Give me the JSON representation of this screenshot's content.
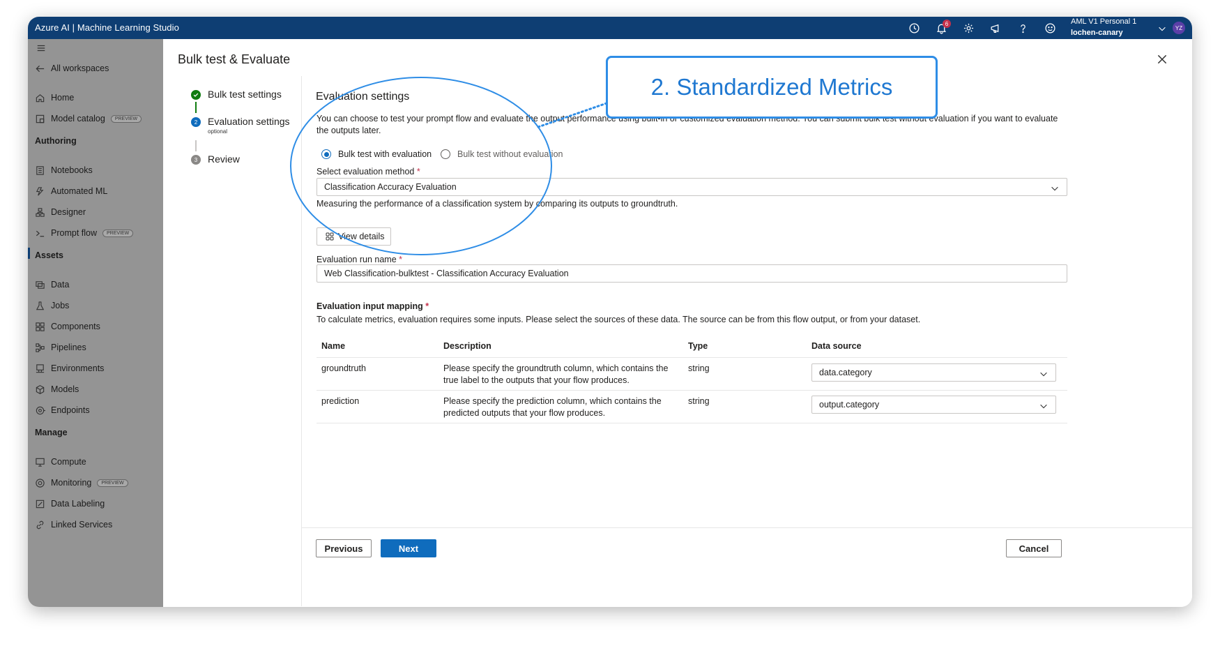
{
  "app": {
    "title": "Azure AI | Machine Learning Studio",
    "notification_count": "6",
    "account_name": "AML V1 Personal 1",
    "account_workspace": "lochen-canary",
    "avatar_initials": "YZ"
  },
  "sidebar": {
    "back": "All workspaces",
    "home": "Home",
    "model_catalog": "Model catalog",
    "preview_badge": "PREVIEW",
    "authoring_header": "Authoring",
    "notebooks": "Notebooks",
    "automated_ml": "Automated ML",
    "designer": "Designer",
    "prompt_flow": "Prompt flow",
    "assets_header": "Assets",
    "data": "Data",
    "jobs": "Jobs",
    "components": "Components",
    "pipelines": "Pipelines",
    "environments": "Environments",
    "models": "Models",
    "endpoints": "Endpoints",
    "manage_header": "Manage",
    "compute": "Compute",
    "monitoring": "Monitoring",
    "data_labeling": "Data Labeling",
    "linked_services": "Linked Services"
  },
  "panel": {
    "title": "Bulk test & Evaluate",
    "steps": {
      "s1": "Bulk test settings",
      "s2": "Evaluation settings",
      "s2_sub": "optional",
      "s2_num": "2",
      "s3": "Review",
      "s3_num": "3"
    },
    "section_title": "Evaluation settings",
    "description": "You can choose to test your prompt flow and evaluate the output performance using built-in or customized evaluation method. You can submit bulk test without evaluation if you want to evaluate the outputs later.",
    "radio_with": "Bulk test with evaluation",
    "radio_without": "Bulk test without evaluation",
    "method_label": "Select evaluation method",
    "method_value": "Classification Accuracy Evaluation",
    "method_desc": "Measuring the performance of a classification system by comparing its outputs to groundtruth.",
    "view_details": "View details",
    "run_name_label": "Evaluation run name",
    "run_name_value": "Web Classification-bulktest - Classification Accuracy Evaluation",
    "mapping_label": "Evaluation input mapping",
    "mapping_desc": "To calculate metrics, evaluation requires some inputs. Please select the sources of these data. The source can be from this flow output, or from your dataset.",
    "required_mark": "*",
    "table": {
      "headers": [
        "Name",
        "Description",
        "Type",
        "Data source"
      ],
      "rows": [
        {
          "name": "groundtruth",
          "description": "Please specify the groundtruth column, which contains the true label to the outputs that your flow produces.",
          "type": "string",
          "source": "data.category"
        },
        {
          "name": "prediction",
          "description": "Please specify the prediction column, which contains the predicted outputs that your flow produces.",
          "type": "string",
          "source": "output.category"
        }
      ]
    },
    "previous": "Previous",
    "next": "Next",
    "cancel": "Cancel"
  },
  "callout": {
    "text": "2. Standardized Metrics",
    "color": "#2e8de6"
  },
  "colors": {
    "topbar": "#0e3e73",
    "sidebar": "#949494",
    "accent": "#0f6cbd",
    "success": "#107c10"
  }
}
